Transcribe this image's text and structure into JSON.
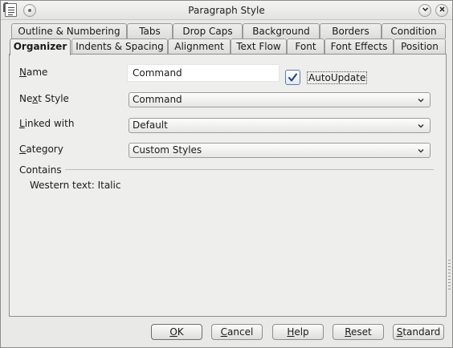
{
  "window": {
    "title": "Paragraph Style"
  },
  "tabs_row1": [
    {
      "label": "Outline & Numbering"
    },
    {
      "label": "Tabs"
    },
    {
      "label": "Drop Caps"
    },
    {
      "label": "Background"
    },
    {
      "label": "Borders"
    },
    {
      "label": "Condition"
    }
  ],
  "tabs_row2": [
    {
      "label": "Organizer",
      "active": true
    },
    {
      "label": "Indents & Spacing"
    },
    {
      "label": "Alignment"
    },
    {
      "label": "Text Flow"
    },
    {
      "label": "Font"
    },
    {
      "label": "Font Effects"
    },
    {
      "label": "Position"
    }
  ],
  "form": {
    "name_label_mnemonic": "N",
    "name_label_rest": "ame",
    "name_value": "Command",
    "autoupdate_label": "AutoUpdate",
    "autoupdate_checked": true,
    "next_style_label_pre": "Ne",
    "next_style_label_mnemonic": "x",
    "next_style_label_rest": "t Style",
    "next_style_value": "Command",
    "linked_with_label_mnemonic": "L",
    "linked_with_label_rest": "inked with",
    "linked_with_value": "Default",
    "category_label_mnemonic": "C",
    "category_label_rest": "ategory",
    "category_value": "Custom Styles"
  },
  "contains": {
    "heading": "Contains",
    "text": "Western text: Italic"
  },
  "buttons": {
    "ok_mnemonic": "O",
    "ok_rest": "K",
    "cancel_mnemonic": "C",
    "cancel_rest": "ancel",
    "help_mnemonic": "H",
    "help_rest": "elp",
    "reset_mnemonic": "R",
    "reset_rest": "eset",
    "standard_mnemonic": "S",
    "standard_rest": "tandard"
  },
  "colors": {
    "dialog_bg": "#e9e9e7",
    "panel_bg": "#eeeeec",
    "checkbox_accent": "#5a7bb2"
  },
  "icons": {
    "app": "paragraph-style-doc-icon",
    "menu": "window-menu-icon",
    "minimize": "chevron-down-icon",
    "close": "close-icon",
    "checkbox": "checkmark-icon",
    "combo": "chevron-down-icon"
  }
}
